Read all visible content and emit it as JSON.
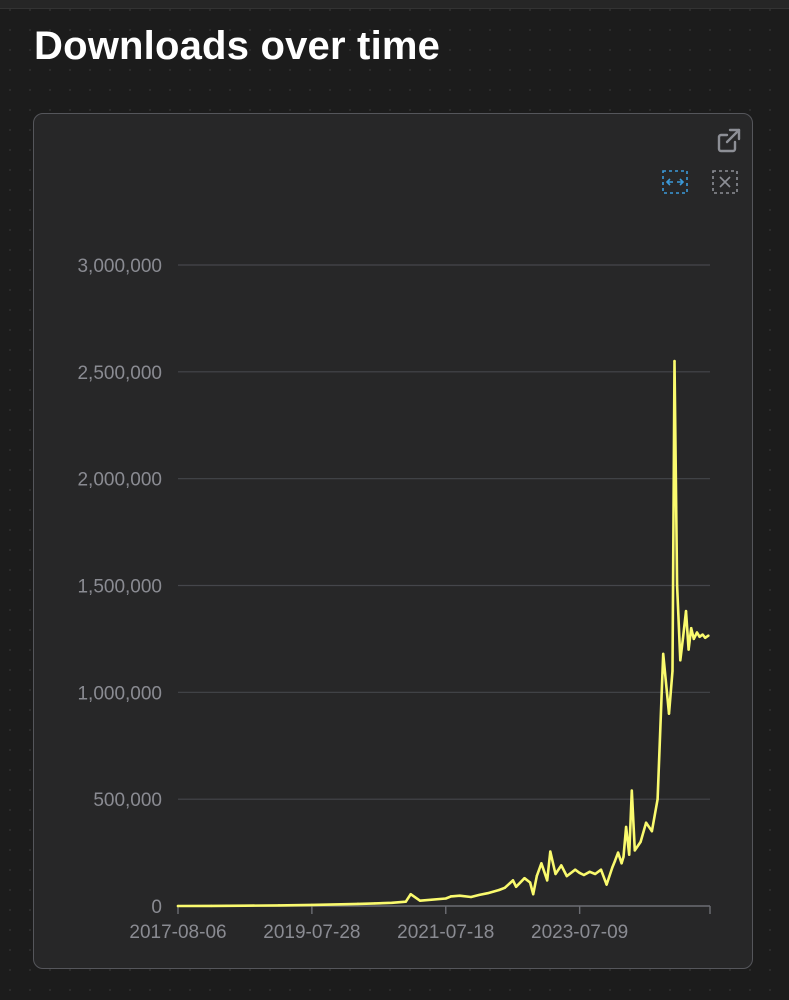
{
  "page": {
    "title": "Downloads over time"
  },
  "toolbar": {
    "icons": [
      "external-link-icon",
      "zoom-select-icon",
      "zoom-reset-icon"
    ],
    "accent": "#3b9ad9",
    "muted": "#8d8f96"
  },
  "colors": {
    "line": "#fafa6e",
    "grid": "#45464b",
    "axis_text": "#8a8b92"
  },
  "chart_data": {
    "type": "line",
    "title": "",
    "xlabel": "",
    "ylabel": "",
    "x_ticks": [
      "2017-08-06",
      "2019-07-28",
      "2021-07-18",
      "2023-07-09"
    ],
    "y_ticks": [
      "0",
      "500,000",
      "1,000,000",
      "1,500,000",
      "2,000,000",
      "2,500,000",
      "3,000,000"
    ],
    "xlim": [
      "2017-08-06",
      "2025-06-10"
    ],
    "ylim": [
      0,
      3000000
    ],
    "grid": true,
    "legend": "none",
    "series": [
      {
        "x": [
          "2017-08-06",
          "2018-02-01",
          "2018-08-01",
          "2019-02-01",
          "2019-07-28",
          "2020-01-01",
          "2020-04-01",
          "2020-07-01",
          "2020-10-01",
          "2020-12-15",
          "2021-01-10",
          "2021-03-01",
          "2021-07-18",
          "2021-08-15",
          "2021-10-01",
          "2021-12-01",
          "2022-01-15",
          "2022-03-01",
          "2022-05-01",
          "2022-06-01",
          "2022-07-15",
          "2022-08-01",
          "2022-09-15",
          "2022-10-15",
          "2022-11-01",
          "2022-11-20",
          "2022-12-15",
          "2023-01-15",
          "2023-02-01",
          "2023-03-01",
          "2023-04-01",
          "2023-05-01",
          "2023-06-15",
          "2023-07-09",
          "2023-08-01",
          "2023-09-01",
          "2023-10-01",
          "2023-11-01",
          "2023-12-01",
          "2024-01-01",
          "2024-01-15",
          "2024-02-01",
          "2024-02-20",
          "2024-03-01",
          "2024-03-15",
          "2024-04-01",
          "2024-04-15",
          "2024-05-01",
          "2024-06-01",
          "2024-07-01",
          "2024-08-01",
          "2024-09-01",
          "2024-10-01",
          "2024-11-01",
          "2024-11-20",
          "2024-12-01",
          "2024-12-15",
          "2025-01-01",
          "2025-01-15",
          "2025-02-01",
          "2025-02-15",
          "2025-03-01",
          "2025-03-15",
          "2025-04-01",
          "2025-04-15",
          "2025-05-01",
          "2025-05-15",
          "2025-06-01"
        ],
        "y": [
          0,
          500,
          1500,
          3000,
          5000,
          8000,
          10000,
          12000,
          15000,
          20000,
          55000,
          25000,
          35000,
          45000,
          48000,
          42000,
          52000,
          60000,
          75000,
          85000,
          120000,
          90000,
          130000,
          110000,
          55000,
          140000,
          200000,
          120000,
          255000,
          150000,
          190000,
          140000,
          170000,
          155000,
          145000,
          160000,
          150000,
          170000,
          100000,
          180000,
          210000,
          250000,
          200000,
          230000,
          370000,
          240000,
          540000,
          260000,
          300000,
          390000,
          350000,
          500000,
          1180000,
          900000,
          1100000,
          2550000,
          1500000,
          1150000,
          1250000,
          1380000,
          1200000,
          1300000,
          1250000,
          1280000,
          1260000,
          1270000,
          1255000,
          1265000
        ]
      }
    ]
  }
}
